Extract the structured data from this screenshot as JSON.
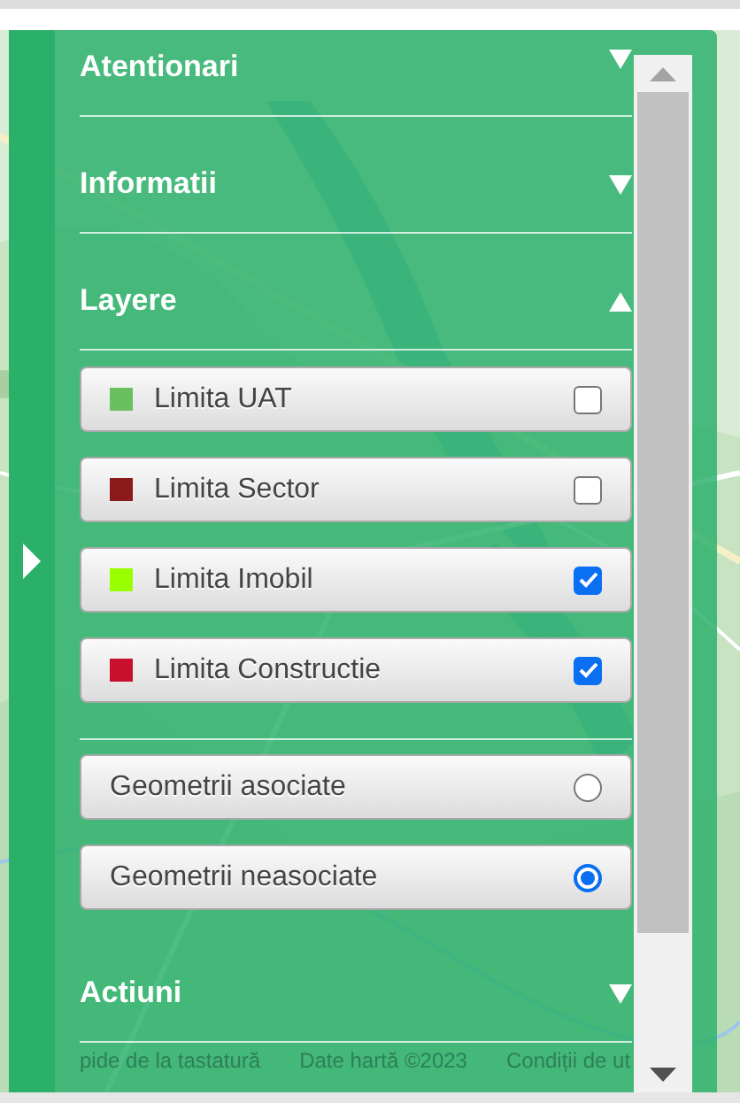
{
  "sections": [
    {
      "title": "Atentionari",
      "expanded": false
    },
    {
      "title": "Informatii",
      "expanded": false
    },
    {
      "title": "Layere",
      "expanded": true,
      "layers": [
        {
          "label": "Limita UAT",
          "color": "#6abf5e",
          "checked": false
        },
        {
          "label": "Limita Sector",
          "color": "#8b1a1a",
          "checked": false
        },
        {
          "label": "Limita Imobil",
          "color": "#99ff00",
          "checked": true
        },
        {
          "label": "Limita Constructie",
          "color": "#c8102e",
          "checked": true
        }
      ],
      "geometry_options": [
        {
          "label": "Geometrii asociate",
          "selected": false
        },
        {
          "label": "Geometrii neasociate",
          "selected": true
        }
      ]
    },
    {
      "title": "Actiuni",
      "expanded": false
    }
  ],
  "attribution": [
    "pide de la tastatură",
    "Date hartă ©2023",
    "Condiții de ut"
  ]
}
